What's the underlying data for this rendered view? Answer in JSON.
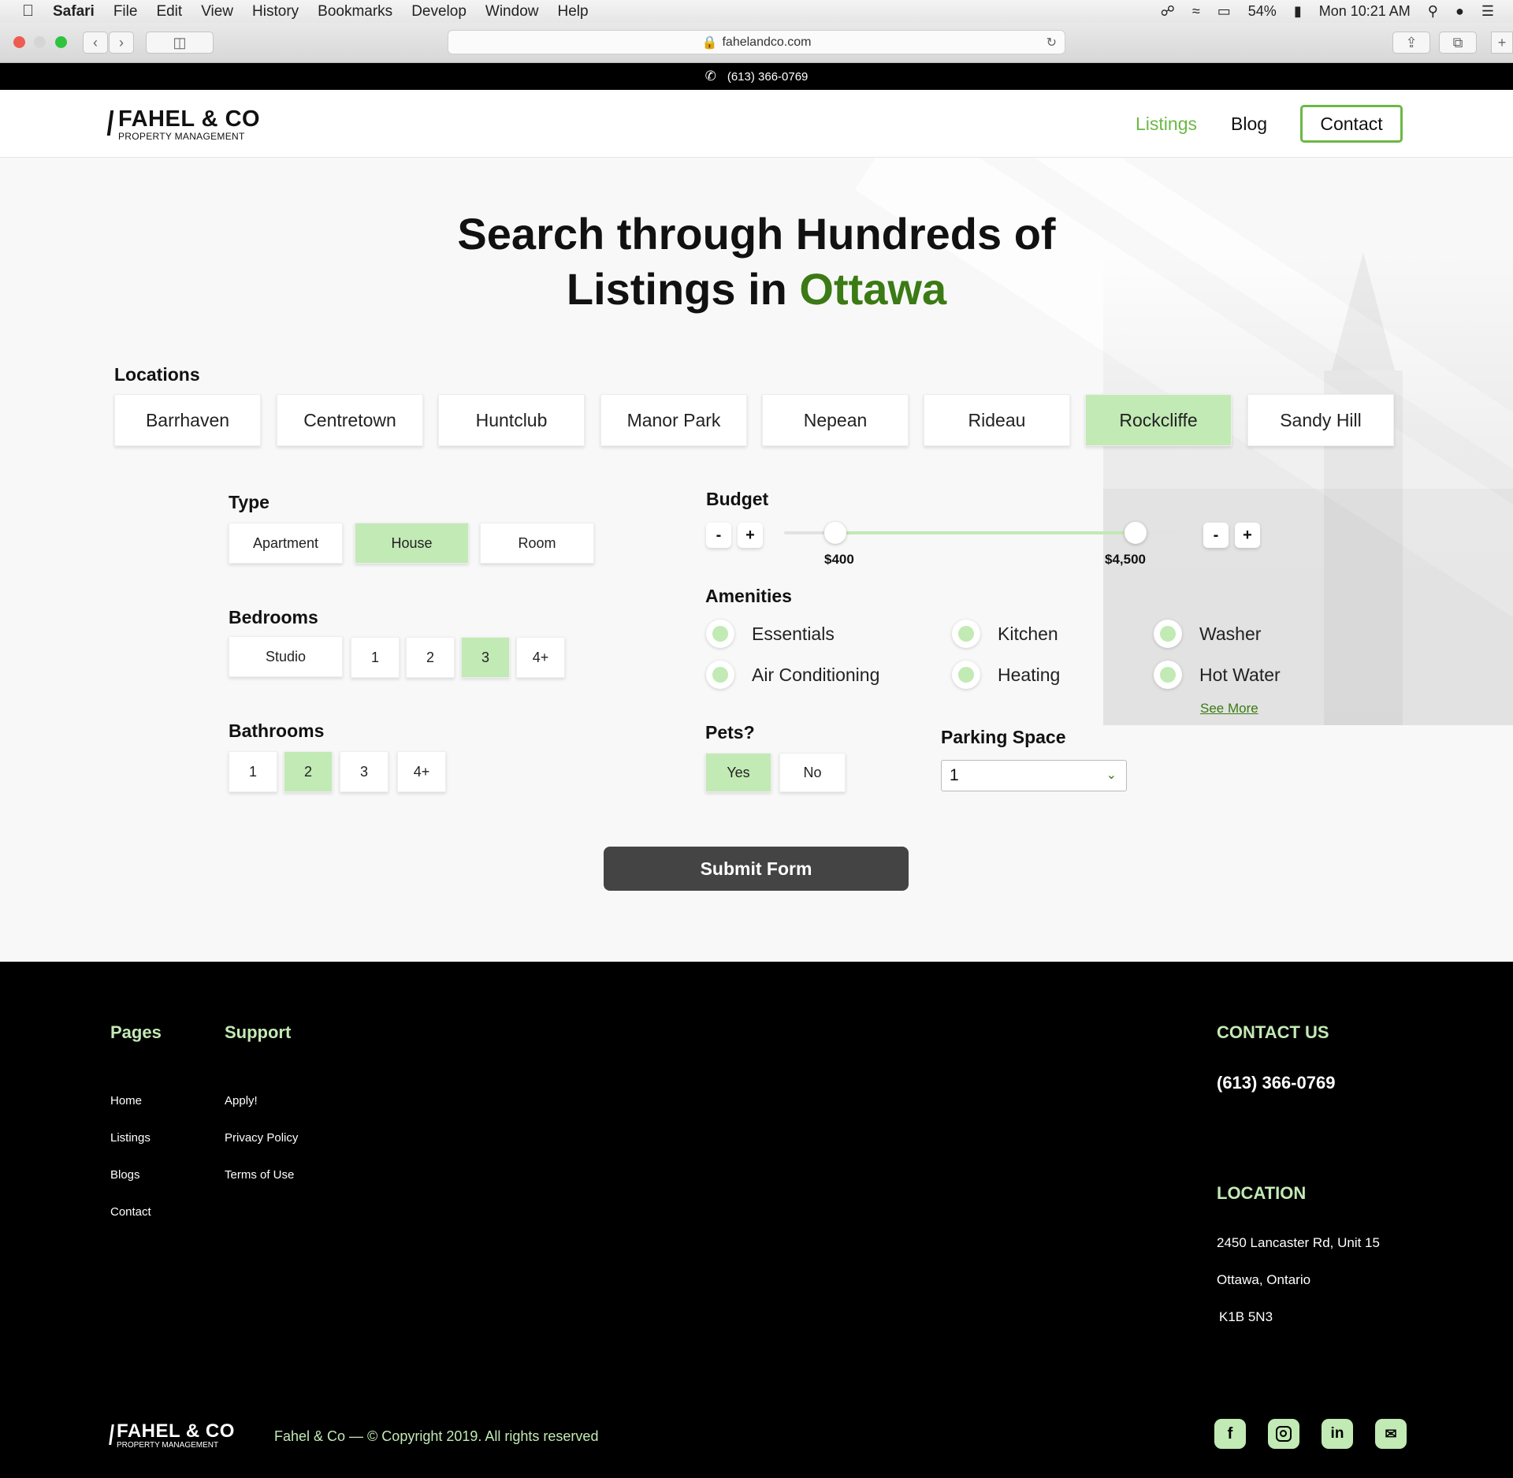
{
  "menubar": {
    "app": "Safari",
    "items": [
      "File",
      "Edit",
      "View",
      "History",
      "Bookmarks",
      "Develop",
      "Window",
      "Help"
    ],
    "battery": "54%",
    "clock": "Mon 10:21 AM"
  },
  "browser": {
    "url": "fahelandco.com"
  },
  "topbar": {
    "phone": "(613) 366-0769"
  },
  "header": {
    "logo_title": "FAHEL & CO",
    "logo_subtitle": "PROPERTY MANAGEMENT",
    "nav": {
      "listings": "Listings",
      "blog": "Blog",
      "contact": "Contact"
    }
  },
  "hero": {
    "headline_line1": "Search through Hundreds of",
    "headline_line2_prefix": "Listings in ",
    "headline_city": "Ottawa"
  },
  "locations": {
    "label": "Locations",
    "items": [
      "Barrhaven",
      "Centretown",
      "Huntclub",
      "Manor Park",
      "Nepean",
      "Rideau",
      "Rockcliffe",
      "Sandy Hill"
    ],
    "selected": "Rockcliffe"
  },
  "type": {
    "label": "Type",
    "options": [
      "Apartment",
      "House",
      "Room"
    ],
    "selected": "House"
  },
  "bedrooms": {
    "label": "Bedrooms",
    "options": [
      "Studio",
      "1",
      "2",
      "3",
      "4+"
    ],
    "selected": "3"
  },
  "bathrooms": {
    "label": "Bathrooms",
    "options": [
      "1",
      "2",
      "3",
      "4+"
    ],
    "selected": "2"
  },
  "budget": {
    "label": "Budget",
    "min_label": "$400",
    "max_label": "$4,500",
    "minus": "-",
    "plus": "+"
  },
  "amenities": {
    "label": "Amenities",
    "items": [
      "Essentials",
      "Kitchen",
      "Washer",
      "Air Conditioning",
      "Heating",
      "Hot Water"
    ],
    "see_more": "See More"
  },
  "pets": {
    "label": "Pets?",
    "options": [
      "Yes",
      "No"
    ],
    "selected": "Yes"
  },
  "parking": {
    "label": "Parking Space",
    "value": "1"
  },
  "submit": {
    "label": "Submit Form"
  },
  "footer": {
    "pages": {
      "heading": "Pages",
      "links": [
        "Home",
        "Listings",
        "Blogs",
        "Contact"
      ]
    },
    "support": {
      "heading": "Support",
      "links": [
        "Apply!",
        "Privacy Policy",
        "Terms of Use"
      ]
    },
    "contact": {
      "heading": "CONTACT US",
      "phone": "(613) 366-0769"
    },
    "location": {
      "heading": "LOCATION",
      "line1": "2450 Lancaster Rd, Unit 15",
      "line2": "Ottawa, Ontario",
      "line3": "K1B 5N3"
    },
    "logo_title": "FAHEL & CO",
    "logo_subtitle": "PROPERTY MANAGEMENT",
    "copyright": "Fahel & Co — © Copyright 2019. All rights reserved",
    "social_icons": [
      "facebook-icon",
      "instagram-icon",
      "linkedin-icon",
      "mail-icon"
    ]
  },
  "colors": {
    "accent_green": "#c2eab4",
    "dark_green": "#3b7a14",
    "nav_green": "#6bb845",
    "submit_bg": "#444444"
  }
}
